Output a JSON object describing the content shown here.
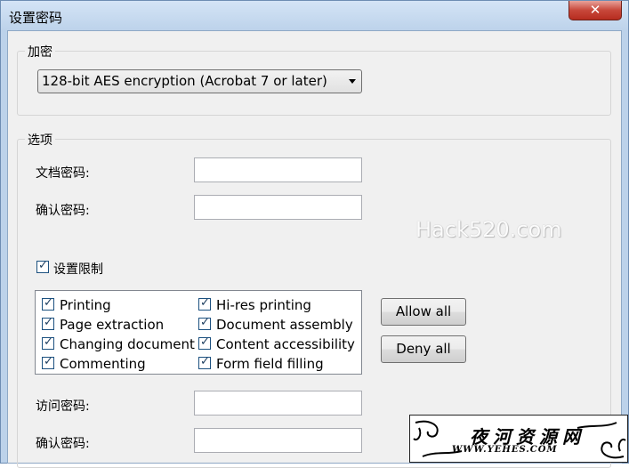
{
  "window": {
    "title": "设置密码",
    "close_glyph": "✕"
  },
  "encryption": {
    "group_label": "加密",
    "selected": "128-bit AES encryption (Acrobat 7 or later)"
  },
  "options": {
    "group_label": "选项",
    "doc_password_label": "文档密码:",
    "doc_password_value": "",
    "confirm_password_label": "确认密码:",
    "confirm_password_value": "",
    "restrictions": {
      "label": "设置限制",
      "checked": true
    },
    "permissions": [
      {
        "label": "Printing",
        "checked": true
      },
      {
        "label": "Hi-res printing",
        "checked": true
      },
      {
        "label": "Page extraction",
        "checked": true
      },
      {
        "label": "Document assembly",
        "checked": true
      },
      {
        "label": "Changing document",
        "checked": true
      },
      {
        "label": "Content accessibility",
        "checked": true
      },
      {
        "label": "Commenting",
        "checked": true
      },
      {
        "label": "Form field filling",
        "checked": true
      }
    ],
    "allow_all_label": "Allow all",
    "deny_all_label": "Deny all",
    "access_password_label": "访问密码:",
    "access_password_value": "",
    "confirm_access_password_label": "确认密码:",
    "confirm_access_password_value": ""
  },
  "watermark": "Hack520.com",
  "logo": {
    "text": "夜河资源网",
    "url": "WWW.YEHES.COM"
  },
  "check_glyph": "✓"
}
